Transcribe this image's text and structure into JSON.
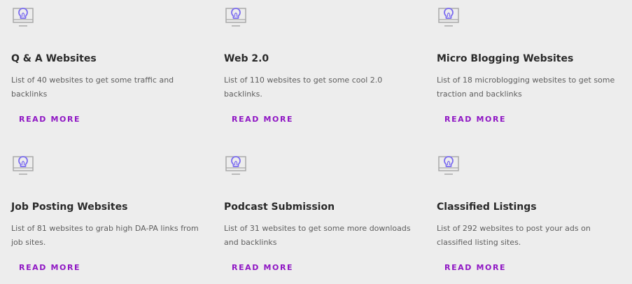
{
  "colors": {
    "background": "#ededed",
    "title": "#2a2a2a",
    "description": "#5e5e5e",
    "link": "#8f16c4",
    "icon_bulb": "#7b6cf0",
    "icon_screen": "#a9a9a9"
  },
  "icon_name": "lightbulb-monitor-icon",
  "cards": [
    {
      "title": "Q & A Websites",
      "description": "List of 40 websites to get some traffic and backlinks",
      "link_label": "READ MORE"
    },
    {
      "title": "Web 2.0",
      "description": "List of 110 websites to get some cool 2.0 backlinks.",
      "link_label": "READ MORE"
    },
    {
      "title": "Micro Blogging Websites",
      "description": "List of 18 microblogging websites to get some traction and backlinks",
      "link_label": "READ MORE"
    },
    {
      "title": "Job Posting Websites",
      "description": "List of 81 websites to grab high DA-PA links from job sites.",
      "link_label": "READ MORE"
    },
    {
      "title": "Podcast Submission",
      "description": "List of 31 websites to get some more downloads and backlinks",
      "link_label": "READ MORE"
    },
    {
      "title": "Classified Listings",
      "description": "List of 292 websites to post your ads on classified listing sites.",
      "link_label": "READ MORE"
    }
  ]
}
